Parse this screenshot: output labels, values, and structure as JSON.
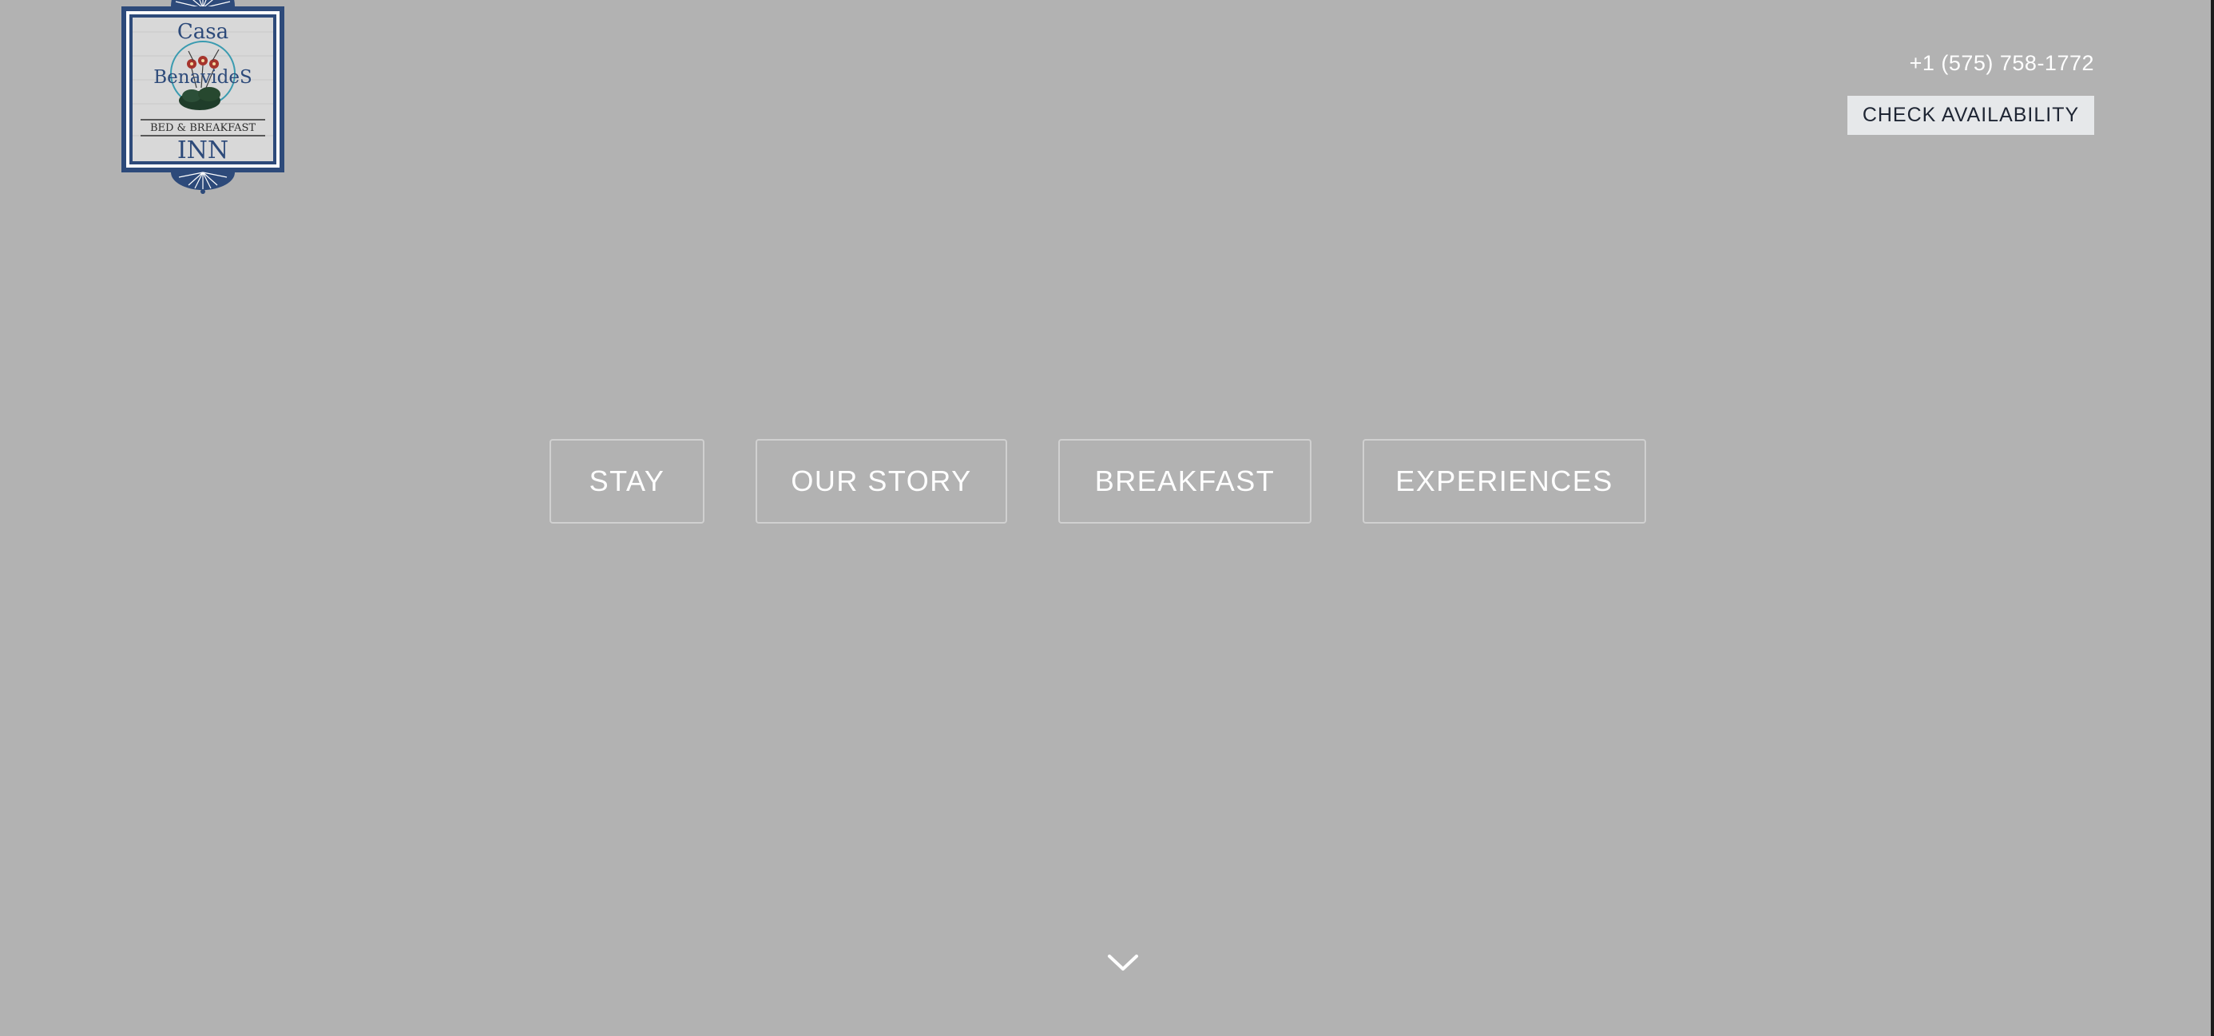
{
  "logo": {
    "line1": "Casa",
    "line2": "BenavideS",
    "line3": "BED & BREAKFAST",
    "line4": "INN",
    "icon": "casa-benavides-logo"
  },
  "header": {
    "phone": "+1 (575) 758-1772",
    "check_availability_label": "CHECK AVAILABILITY"
  },
  "nav": {
    "items": [
      {
        "label": "STAY"
      },
      {
        "label": "OUR STORY"
      },
      {
        "label": "BREAKFAST"
      },
      {
        "label": "EXPERIENCES"
      }
    ]
  },
  "scroll": {
    "icon": "chevron-down-icon"
  },
  "colors": {
    "background": "#b2b2b2",
    "logo_blue": "#2d4a7a",
    "button_bg": "#e6e8ea",
    "button_text": "#1e2533"
  }
}
